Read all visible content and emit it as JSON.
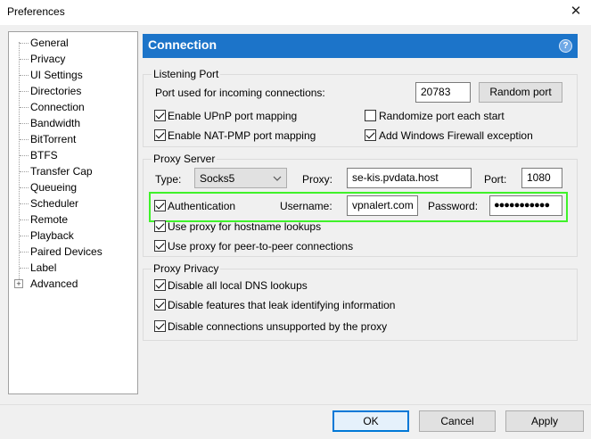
{
  "window": {
    "title": "Preferences",
    "close_glyph": "✕"
  },
  "sidebar": {
    "items": [
      {
        "label": "General"
      },
      {
        "label": "Privacy"
      },
      {
        "label": "UI Settings"
      },
      {
        "label": "Directories"
      },
      {
        "label": "Connection"
      },
      {
        "label": "Bandwidth"
      },
      {
        "label": "BitTorrent"
      },
      {
        "label": "BTFS"
      },
      {
        "label": "Transfer Cap"
      },
      {
        "label": "Queueing"
      },
      {
        "label": "Scheduler"
      },
      {
        "label": "Remote"
      },
      {
        "label": "Playback"
      },
      {
        "label": "Paired Devices"
      },
      {
        "label": "Label"
      },
      {
        "label": "Advanced"
      }
    ],
    "expander_glyph": "+"
  },
  "header": {
    "title": "Connection",
    "help_glyph": "?"
  },
  "listening_port": {
    "group_label": "Listening Port",
    "port_label": "Port used for incoming connections:",
    "port_value": "20783",
    "random_port_button": "Random port",
    "upnp_label": "Enable UPnP port mapping",
    "upnp_checked": true,
    "nat_pmp_label": "Enable NAT-PMP port mapping",
    "nat_pmp_checked": true,
    "randomize_label": "Randomize port each start",
    "randomize_checked": false,
    "firewall_label": "Add Windows Firewall exception",
    "firewall_checked": true
  },
  "proxy_server": {
    "group_label": "Proxy Server",
    "type_label": "Type:",
    "type_value": "Socks5",
    "proxy_label": "Proxy:",
    "proxy_value": "se-kis.pvdata.host",
    "port_label": "Port:",
    "port_value": "1080",
    "auth_label": "Authentication",
    "auth_checked": true,
    "username_label": "Username:",
    "username_value": "vpnalert.com",
    "password_label": "Password:",
    "password_value": "●●●●●●●●●●●",
    "hostname_lookup_label": "Use proxy for hostname lookups",
    "hostname_lookup_checked": true,
    "p2p_label": "Use proxy for peer-to-peer connections",
    "p2p_checked": true
  },
  "proxy_privacy": {
    "group_label": "Proxy Privacy",
    "dns_label": "Disable all local DNS lookups",
    "dns_checked": true,
    "leak_label": "Disable features that leak identifying information",
    "leak_checked": true,
    "unsupported_label": "Disable connections unsupported by the proxy",
    "unsupported_checked": true
  },
  "footer": {
    "ok": "OK",
    "cancel": "Cancel",
    "apply": "Apply"
  },
  "colors": {
    "accent": "#1c74c9",
    "highlight": "#3ff22a"
  }
}
